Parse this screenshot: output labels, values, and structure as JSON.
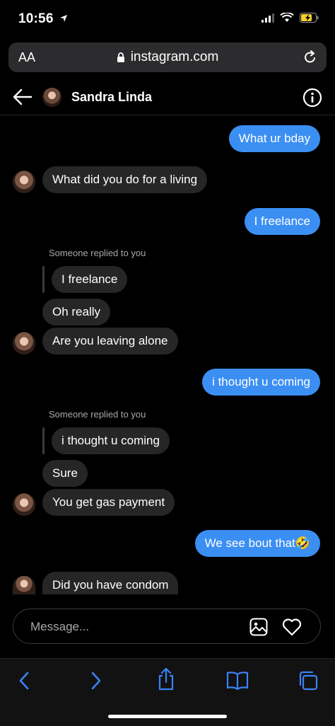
{
  "status": {
    "time": "10:56"
  },
  "browser": {
    "text_size_label": "AA",
    "url": "instagram.com"
  },
  "chat": {
    "contact_name": "Sandra Linda",
    "reply_notice": "Someone replied to you",
    "messages": [
      {
        "from": "me",
        "text": "What ur bday"
      },
      {
        "from": "them",
        "text": "What did you do for a living"
      },
      {
        "from": "me",
        "text": "I freelance"
      },
      {
        "from": "them",
        "quoted": "I freelance"
      },
      {
        "from": "them",
        "text": "Oh really"
      },
      {
        "from": "them",
        "text": "Are you leaving alone"
      },
      {
        "from": "me",
        "text": "i thought u coming"
      },
      {
        "from": "them",
        "quoted": "i thought u coming"
      },
      {
        "from": "them",
        "text": "Sure"
      },
      {
        "from": "them",
        "text": "You get gas payment"
      },
      {
        "from": "me",
        "text": "We see bout that🤣"
      },
      {
        "from": "them",
        "text": "Did you have condom"
      }
    ]
  },
  "composer": {
    "placeholder": "Message..."
  },
  "colors": {
    "outgoing": "#3b8ff3",
    "incoming": "#262626",
    "safari_accent": "#3b82f6"
  }
}
